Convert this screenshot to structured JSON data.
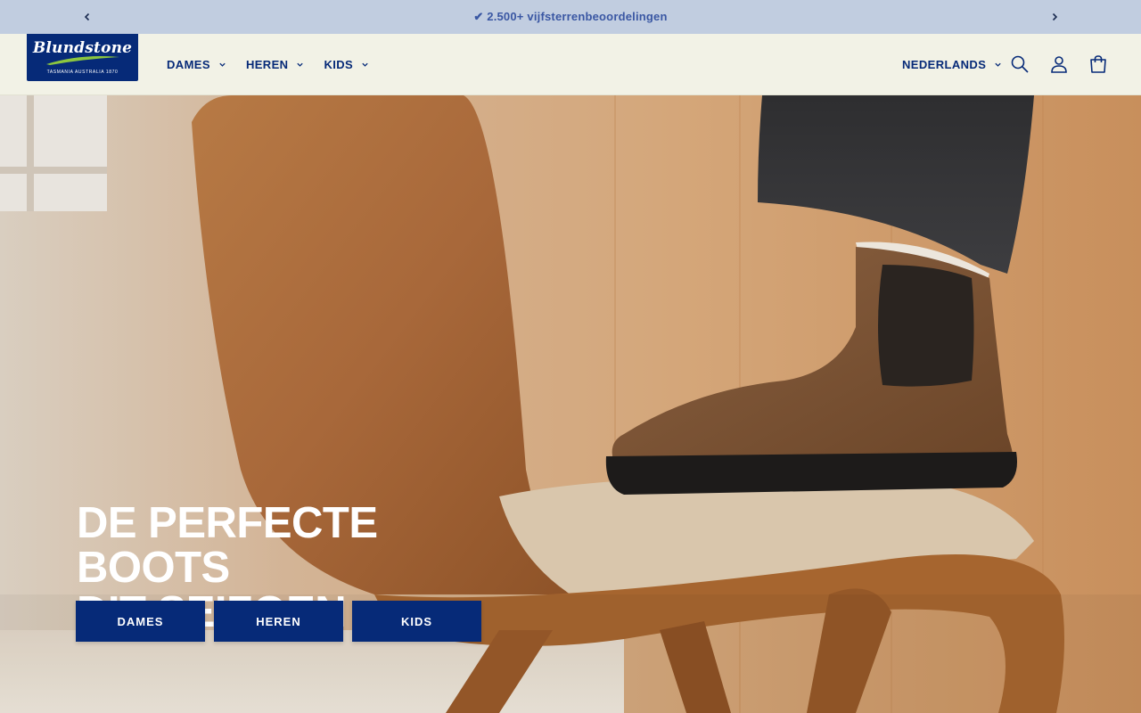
{
  "announcement": {
    "text": "✔ 2.500+ vijfsterrenbeoordelingen",
    "prev_icon": "chevron-left-icon",
    "next_icon": "chevron-right-icon"
  },
  "header": {
    "logo": {
      "wordmark": "Blundstone",
      "tagline": "TASMANIA AUSTRALIA 1870"
    },
    "nav": [
      {
        "label": "DAMES"
      },
      {
        "label": "HEREN"
      },
      {
        "label": "KIDS"
      }
    ],
    "language": "NEDERLANDS",
    "icons": [
      "search-icon",
      "account-icon",
      "cart-icon"
    ]
  },
  "hero": {
    "title_line1": "DE PERFECTE BOOTS",
    "title_line2": "DIT SEIZOEN",
    "buttons": [
      {
        "label": "DAMES"
      },
      {
        "label": "HEREN"
      },
      {
        "label": "KIDS"
      }
    ]
  },
  "colors": {
    "brand_navy": "#062a78",
    "announcement_bg": "#c1cde0",
    "header_bg": "#f2f2e6"
  }
}
